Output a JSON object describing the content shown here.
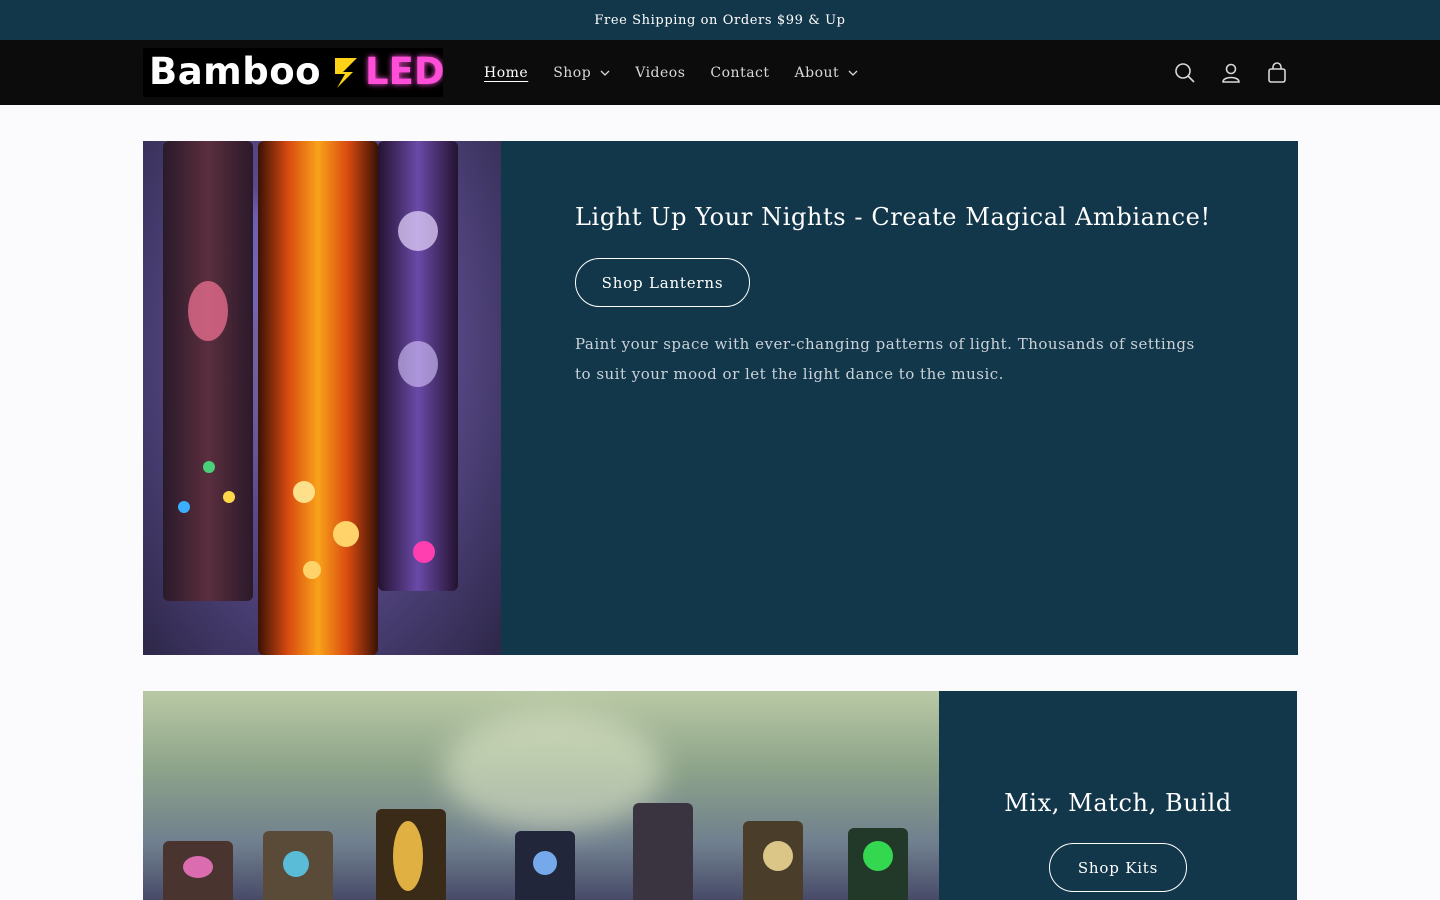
{
  "announcement": "Free Shipping on Orders $99 & Up",
  "logo": {
    "text_main": "Bamboo",
    "text_accent": "LED"
  },
  "nav": {
    "home": "Home",
    "shop": "Shop",
    "videos": "Videos",
    "contact": "Contact",
    "about": "About"
  },
  "header_icons": [
    "search-icon",
    "account-icon",
    "cart-icon"
  ],
  "colors": {
    "announcement_bg": "#12364a",
    "header_bg": "#0c0c0c",
    "section_bg": "#12364a",
    "logo_accent": "#ff4fd8"
  },
  "sections": [
    {
      "heading": "Light Up Your Nights - Create Magical Ambiance!",
      "button": "Shop Lanterns",
      "text": "Paint your space with ever-changing patterns of light. Thousands of settings to suit your mood or let the light dance to the music."
    },
    {
      "heading": "Mix, Match, Build",
      "button": "Shop Kits"
    }
  ]
}
